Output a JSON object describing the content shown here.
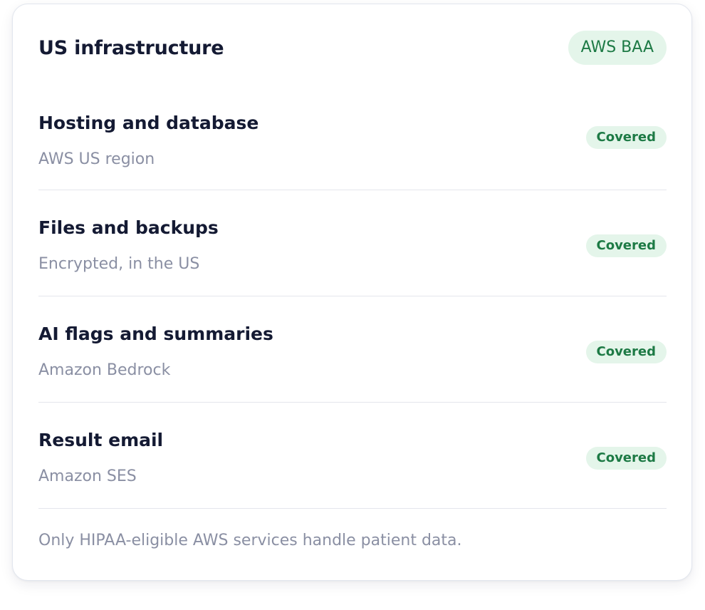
{
  "card": {
    "title": "US infrastructure",
    "badge": "AWS BAA",
    "rows": [
      {
        "title": "Hosting and database",
        "subtitle": "AWS US region",
        "status": "Covered"
      },
      {
        "title": "Files and backups",
        "subtitle": "Encrypted, in the US",
        "status": "Covered"
      },
      {
        "title": "AI flags and summaries",
        "subtitle": "Amazon Bedrock",
        "status": "Covered"
      },
      {
        "title": "Result email",
        "subtitle": "Amazon SES",
        "status": "Covered"
      }
    ],
    "footer": "Only HIPAA-eligible AWS services handle patient data."
  },
  "colors": {
    "badge_background": "#e4f5ea",
    "badge_text": "#1d7a45",
    "title_text": "#141a33",
    "muted_text": "#8a8fa3"
  }
}
